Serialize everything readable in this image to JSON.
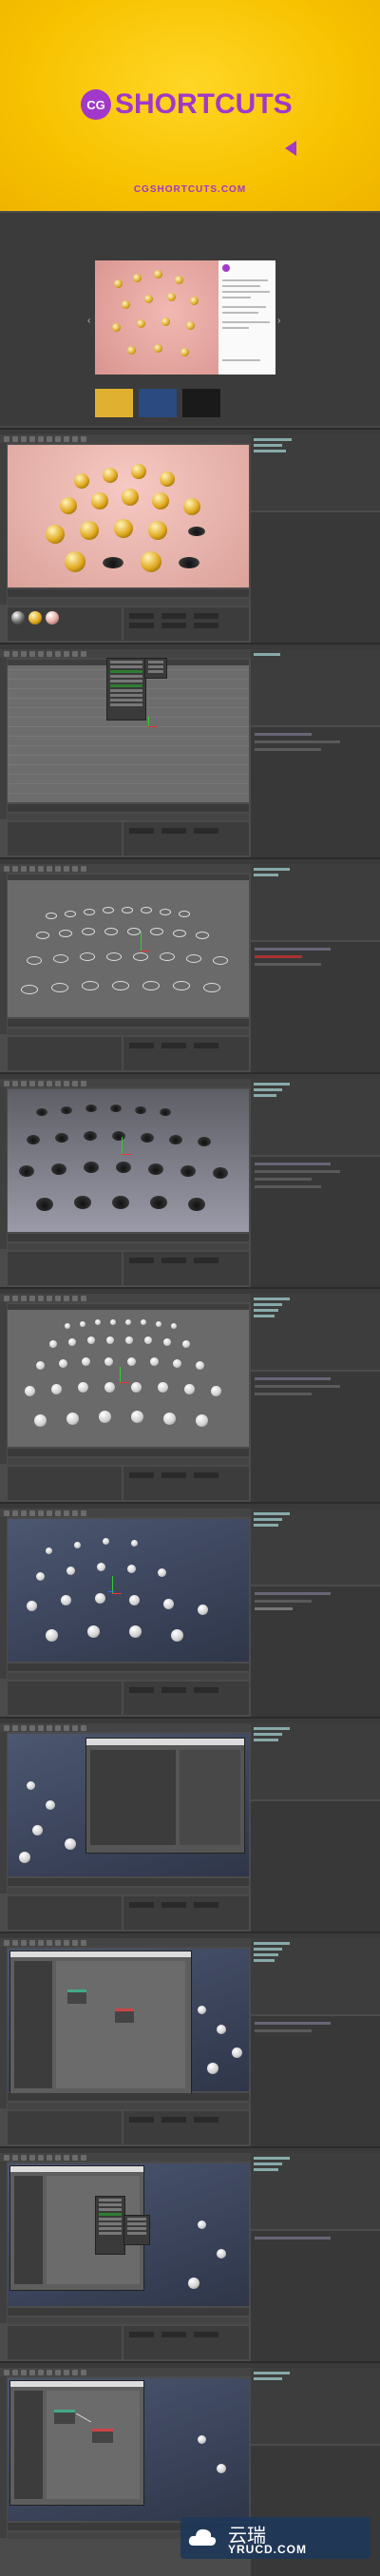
{
  "hero": {
    "logo_badge": "CG",
    "brand": "SHORTCUTS",
    "url": "CGSHORTCUTS.COM",
    "colors": {
      "background": "#f7c200",
      "brand": "#a238c9"
    }
  },
  "watermark": {
    "title": "云瑞",
    "subtitle": "YRUCD.COM"
  },
  "screens": [
    {
      "step": "render-preview",
      "scene": "gold spheres on pink plane"
    },
    {
      "step": "menu-open",
      "scene": "empty grid viewport"
    },
    {
      "step": "circle-array",
      "scene": "ring pattern on plane"
    },
    {
      "step": "extruded-holes",
      "scene": "plane with holes"
    },
    {
      "step": "sphere-grid",
      "scene": "white spheres grid"
    },
    {
      "step": "spheres-in-holes",
      "scene": "blue viewport with spheres"
    },
    {
      "step": "dialog-open",
      "scene": "settings dialog over viewport"
    },
    {
      "step": "xpresso-editor",
      "scene": "node editor window"
    },
    {
      "step": "xpresso-context-menu",
      "scene": "node editor with menu"
    },
    {
      "step": "xpresso-nodes",
      "scene": "connected nodes"
    }
  ]
}
